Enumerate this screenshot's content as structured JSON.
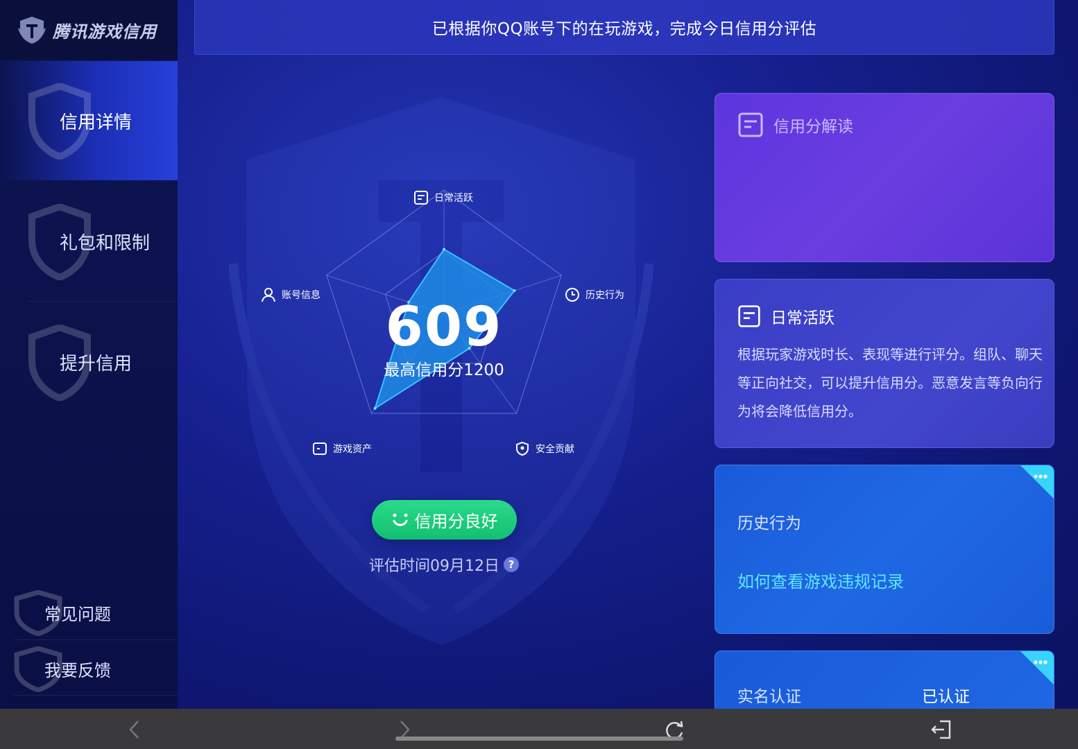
{
  "app": {
    "logo_text": "腾讯游戏信用"
  },
  "sidebar": {
    "items": [
      {
        "label": "信用详情",
        "active": true
      },
      {
        "label": "礼包和限制",
        "active": false
      },
      {
        "label": "提升信用",
        "active": false
      }
    ],
    "bottom_items": [
      {
        "label": "常见问题"
      },
      {
        "label": "我要反馈"
      }
    ]
  },
  "banner": {
    "text": "已根据你QQ账号下的在玩游戏，完成今日信用分评估"
  },
  "radar": {
    "score": "609",
    "max_label": "最高信用分1200",
    "axes": [
      {
        "label": "日常活跃",
        "icon": "document-icon",
        "value": 0.52
      },
      {
        "label": "历史行为",
        "icon": "clock-icon",
        "value": 0.6
      },
      {
        "label": "安全贡献",
        "icon": "shield-icon",
        "value": 0.35
      },
      {
        "label": "游戏资产",
        "icon": "asset-icon",
        "value": 0.95
      },
      {
        "label": "账号信息",
        "icon": "user-icon",
        "value": 0.3
      }
    ],
    "fill_color": "#1e90e8"
  },
  "status": {
    "badge": "信用分良好",
    "eval_time": "评估时间09月12日",
    "badge_color": "#1ccc7c"
  },
  "cards": {
    "interpret": {
      "title": "信用分解读"
    },
    "daily": {
      "title": "日常活跃",
      "body": "根据玩家游戏时长、表现等进行评分。组队、聊天等正向社交，可以提升信用分。恶意发言等负向行为将会降低信用分。"
    },
    "history": {
      "title": "历史行为",
      "link": "如何查看游戏违规记录"
    },
    "realname": {
      "title": "实名认证",
      "value": "已认证"
    }
  }
}
